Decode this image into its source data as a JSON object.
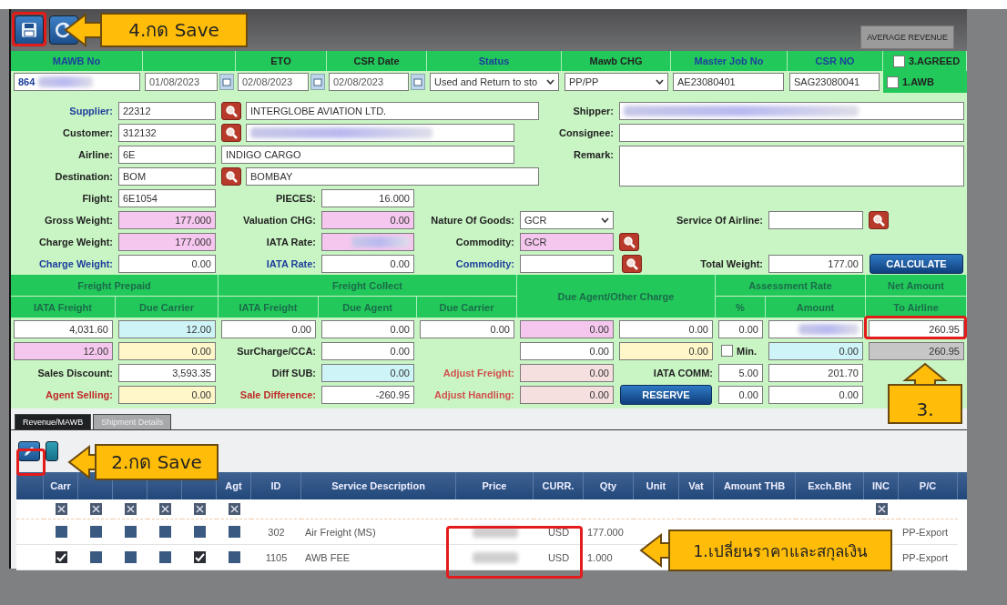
{
  "toolbar": {
    "right_button": "AVERAGE REVENUE"
  },
  "header": [
    {
      "kind": "label",
      "text": "MAWB No",
      "color": "#1d3f9c"
    },
    {
      "kind": "blank"
    },
    {
      "kind": "label",
      "text": "ETO",
      "color": "#222222"
    },
    {
      "kind": "label",
      "text": "CSR Date",
      "color": "#222222"
    },
    {
      "kind": "label",
      "text": "Status",
      "color": "#1d3f9c"
    },
    {
      "kind": "label",
      "text": "Mawb CHG",
      "color": "#222222"
    },
    {
      "kind": "label",
      "text": "Master Job No",
      "color": "#1d3f9c"
    },
    {
      "kind": "label",
      "text": "CSR NO",
      "color": "#1d3f9c"
    },
    {
      "kind": "checkbox",
      "text": "3.AGREED",
      "checked": false
    }
  ],
  "values": [
    {
      "kind": "text",
      "value": "864",
      "redacted": true,
      "color": "#ffffff"
    },
    {
      "kind": "date",
      "value": "01/08/2023"
    },
    {
      "kind": "date",
      "value": "02/08/2023"
    },
    {
      "kind": "date",
      "value": "02/08/2023"
    },
    {
      "kind": "select",
      "value": "Used and Return to sto"
    },
    {
      "kind": "select",
      "value": "PP/PP"
    },
    {
      "kind": "text",
      "value": "AE23080401",
      "color": "#ffffff"
    },
    {
      "kind": "text",
      "value": "SAG23080041",
      "color": "#ffffff"
    },
    {
      "kind": "checkbox",
      "text": "1.AWB",
      "checked": false
    }
  ],
  "form": [
    [
      {
        "kind": "label",
        "text": "Supplier:",
        "color": "#1d3f9c"
      },
      {
        "kind": "text",
        "value": "22312",
        "color": "#ffffff"
      },
      {
        "kind": "search"
      },
      {
        "kind": "text",
        "value": "INTERGLOBE AVIATION LTD.",
        "color": "#ffffff"
      },
      {
        "kind": "label",
        "text": "Shipper:",
        "color": "#222222"
      },
      {
        "kind": "text",
        "redacted": true,
        "color": "#ffffff"
      }
    ],
    [
      {
        "kind": "label",
        "text": "Customer:",
        "color": "#222222"
      },
      {
        "kind": "text",
        "value": "312132",
        "color": "#ffffff"
      },
      {
        "kind": "search"
      },
      {
        "kind": "text",
        "redacted": true,
        "color": "#ffffff"
      },
      {
        "kind": "label",
        "text": "Consignee:",
        "color": "#222222"
      },
      {
        "kind": "text",
        "color": "#ffffff"
      }
    ],
    [
      {
        "kind": "label",
        "text": "Airline:",
        "color": "#222222"
      },
      {
        "kind": "text",
        "value": "6E",
        "color": "#ffffff"
      },
      {
        "kind": "text",
        "value": "INDIGO CARGO",
        "color": "#ffffff"
      },
      {
        "kind": "label",
        "text": "Remark:",
        "color": "#222222"
      },
      {
        "kind": "textarea"
      }
    ],
    [
      {
        "kind": "label",
        "text": "Destination:",
        "color": "#222222"
      },
      {
        "kind": "text",
        "value": "BOM",
        "color": "#ffffff"
      },
      {
        "kind": "search"
      },
      {
        "kind": "text",
        "value": "BOMBAY",
        "color": "#ffffff"
      }
    ],
    [
      {
        "kind": "label",
        "text": "Flight:",
        "color": "#222222"
      },
      {
        "kind": "text",
        "value": "6E1054",
        "color": "#ffffff"
      },
      {
        "kind": "label",
        "text": "PIECES:",
        "color": "#222222"
      },
      {
        "kind": "number",
        "value": "16.000",
        "color": "#ffffff"
      }
    ],
    [
      {
        "kind": "label",
        "text": "Gross Weight:",
        "color": "#222222"
      },
      {
        "kind": "number",
        "value": "177.000",
        "color": "#f6c7ee"
      },
      {
        "kind": "label",
        "text": "Valuation CHG:",
        "color": "#222222"
      },
      {
        "kind": "number",
        "value": "0.00",
        "color": "#f6c7ee"
      },
      {
        "kind": "label",
        "text": "Nature Of Goods:",
        "color": "#222222"
      },
      {
        "kind": "select",
        "value": "GCR"
      },
      {
        "kind": "label",
        "text": "Service Of Airline:",
        "color": "#222222"
      },
      {
        "kind": "text",
        "color": "#ffffff"
      },
      {
        "kind": "search"
      }
    ],
    [
      {
        "kind": "label",
        "text": "Charge Weight:",
        "color": "#222222"
      },
      {
        "kind": "number",
        "value": "177.000",
        "color": "#f6c7ee"
      },
      {
        "kind": "label",
        "text": "IATA Rate:",
        "color": "#222222"
      },
      {
        "kind": "number",
        "redacted": true,
        "color": "#f6c7ee"
      },
      {
        "kind": "label",
        "text": "Commodity:",
        "color": "#222222"
      },
      {
        "kind": "text",
        "value": "GCR",
        "color": "#f6c7ee"
      },
      {
        "kind": "search"
      }
    ],
    [
      {
        "kind": "label",
        "text": "Charge Weight:",
        "color": "#1d3f9c"
      },
      {
        "kind": "number",
        "value": "0.00",
        "color": "#ffffff"
      },
      {
        "kind": "label",
        "text": "IATA Rate:",
        "color": "#1d3f9c"
      },
      {
        "kind": "number",
        "value": "0.00",
        "color": "#ffffff"
      },
      {
        "kind": "label",
        "text": "Commodity:",
        "color": "#1d3f9c"
      },
      {
        "kind": "text",
        "color": "#ffffff"
      },
      {
        "kind": "search"
      },
      {
        "kind": "label",
        "text": "Total Weight:",
        "color": "#222222"
      },
      {
        "kind": "number",
        "value": "177.00",
        "color": "#ffffff"
      },
      {
        "kind": "button",
        "text": "CALCULATE"
      }
    ],
    [
      {
        "kind": "heading",
        "text": "Freight Prepaid"
      },
      {
        "kind": "heading",
        "text": "Freight Collect"
      },
      {
        "kind": "heading",
        "text": "Due Agent/Other Charge"
      },
      {
        "kind": "heading",
        "text": "Assessment Rate"
      },
      {
        "kind": "heading",
        "text": "Net Amount"
      }
    ],
    [
      {
        "kind": "heading",
        "text": "IATA Freight"
      },
      {
        "kind": "heading",
        "text": "Due Carrier"
      },
      {
        "kind": "heading",
        "text": "IATA Freight"
      },
      {
        "kind": "heading",
        "text": "Due Agent"
      },
      {
        "kind": "heading",
        "text": "Due Carrier"
      },
      {
        "kind": "heading",
        "text": "%"
      },
      {
        "kind": "heading",
        "text": "Amount"
      },
      {
        "kind": "heading",
        "text": "To Airline"
      }
    ],
    [
      {
        "kind": "number",
        "value": "4,031.60",
        "color": "#ffffff"
      },
      {
        "kind": "number",
        "value": "12.00",
        "color": "#cff4f8"
      },
      {
        "kind": "number",
        "value": "0.00",
        "color": "#ffffff"
      },
      {
        "kind": "number",
        "value": "0.00",
        "color": "#ffffff"
      },
      {
        "kind": "number",
        "value": "0.00",
        "color": "#ffffff"
      },
      {
        "kind": "number",
        "value": "0.00",
        "color": "#f6c7ee"
      },
      {
        "kind": "number",
        "value": "0.00",
        "color": "#ffffff"
      },
      {
        "kind": "number",
        "value": "0.00",
        "color": "#ffffff"
      },
      {
        "kind": "number",
        "redacted": true,
        "color": "#ffffff"
      },
      {
        "kind": "number",
        "value": "260.95",
        "color": "#ffffff"
      }
    ],
    [
      {
        "kind": "number",
        "value": "12.00",
        "color": "#f6c7ee"
      },
      {
        "kind": "number",
        "value": "0.00",
        "color": "#fff6c9"
      },
      {
        "kind": "label",
        "text": "SurCharge/CCA:",
        "color": "#222222"
      },
      {
        "kind": "number",
        "value": "0.00",
        "color": "#ffffff"
      },
      {
        "kind": "number",
        "value": "0.00",
        "color": "#ffffff"
      },
      {
        "kind": "number",
        "value": "0.00",
        "color": "#fff6c9"
      },
      {
        "kind": "checkbox",
        "text": "Min.",
        "checked": false
      },
      {
        "kind": "number",
        "value": "0.00",
        "color": "#cff4f8"
      },
      {
        "kind": "number",
        "value": "260.95",
        "color": "#c6c6c6"
      }
    ],
    [
      {
        "kind": "label",
        "text": "Sales Discount:",
        "color": "#222222"
      },
      {
        "kind": "number",
        "value": "3,593.35",
        "color": "#ffffff"
      },
      {
        "kind": "label",
        "text": "Diff SUB:",
        "color": "#222222"
      },
      {
        "kind": "number",
        "value": "0.00",
        "color": "#cff4f8"
      },
      {
        "kind": "label",
        "text": "Adjust Freight:",
        "color": "#d2504f"
      },
      {
        "kind": "number",
        "value": "0.00",
        "color": "#f6dfdf"
      },
      {
        "kind": "label",
        "text": "IATA COMM:",
        "color": "#222222"
      },
      {
        "kind": "number",
        "value": "5.00",
        "color": "#ffffff"
      },
      {
        "kind": "number",
        "value": "201.70",
        "color": "#ffffff"
      }
    ],
    [
      {
        "kind": "label",
        "text": "Agent Selling:",
        "color": "#c02a2a"
      },
      {
        "kind": "number",
        "value": "0.00",
        "color": "#fff6c9"
      },
      {
        "kind": "label",
        "text": "Sale Difference:",
        "color": "#c02a2a"
      },
      {
        "kind": "number",
        "value": "-260.95",
        "color": "#ffffff"
      },
      {
        "kind": "label",
        "text": "Adjust Handling:",
        "color": "#d2504f"
      },
      {
        "kind": "number",
        "value": "0.00",
        "color": "#f6dfdf"
      },
      {
        "kind": "button",
        "text": "RESERVE"
      },
      {
        "kind": "number",
        "value": "0.00",
        "color": "#ffffff"
      },
      {
        "kind": "number",
        "value": "0.00",
        "color": "#ffffff"
      }
    ]
  ],
  "tabs": [
    {
      "label": "Revenue/MAWB",
      "selected": true
    },
    {
      "label": "Shipment Details",
      "selected": false
    }
  ],
  "table": {
    "check_columns": {
      "first": "Carr",
      "last": "Agt"
    },
    "columns": [
      "ID",
      "Service Description",
      "Price",
      "CURR.",
      "Qty",
      "Unit",
      "Vat",
      "Amount THB",
      "Exch.Bht",
      "INC",
      "P/C"
    ],
    "filter": {
      "checks": [
        true,
        true,
        true,
        true,
        true,
        true
      ],
      "inc": true
    },
    "rows": [
      {
        "checks": [
          false,
          false,
          false,
          false,
          false,
          false
        ],
        "id": "302",
        "description": "Air Freight (MS)",
        "price_redacted": true,
        "currency": "USD",
        "qty": "177.000",
        "pc": "PP-Export"
      },
      {
        "checks": [
          true,
          false,
          false,
          false,
          true,
          false
        ],
        "id": "1105",
        "description": "AWB FEE",
        "price_redacted": true,
        "currency": "USD",
        "qty": "1.000",
        "pc": "PP-Export"
      }
    ]
  },
  "annotations": [
    {
      "text": "4.กด Save",
      "kind": "arrow-left"
    },
    {
      "text": "3.",
      "kind": "arrow-up"
    },
    {
      "text": "2.กด Save",
      "kind": "arrow-left"
    },
    {
      "text": "1.เปลี่ยนราคาและสกุลเงิน",
      "kind": "arrow-left"
    }
  ]
}
